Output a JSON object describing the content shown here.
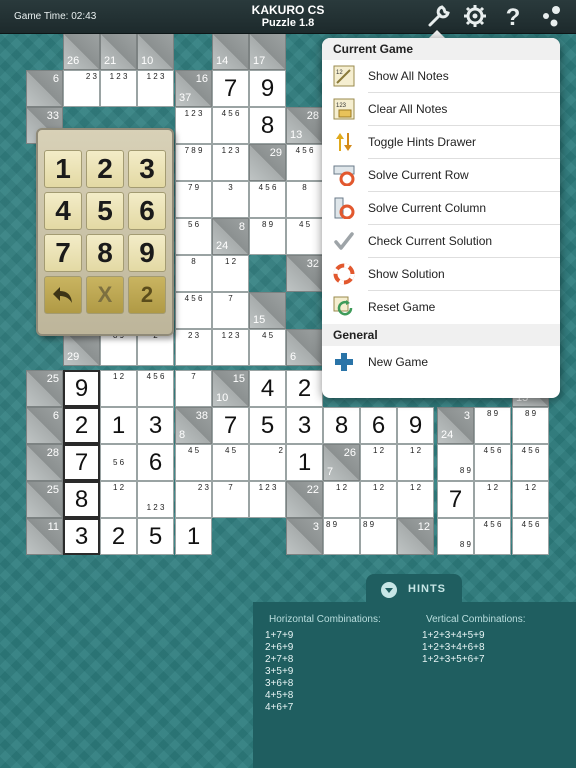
{
  "topbar": {
    "game_time": "Game Time: 02:43",
    "title": "KAKURO CS",
    "subtitle": "Puzzle 1.8",
    "icons": [
      "wrench-icon",
      "gear-icon",
      "help-icon",
      "dots-icon"
    ]
  },
  "numpad": {
    "keys": [
      "1",
      "2",
      "3",
      "4",
      "5",
      "6",
      "7",
      "8",
      "9"
    ],
    "undo_icon": "undo-icon",
    "clear_label": "X",
    "notes_label": "2"
  },
  "menu": {
    "section1": "Current Game",
    "items": [
      {
        "label": "Show All Notes",
        "icon": "show-notes-icon"
      },
      {
        "label": "Clear All Notes",
        "icon": "clear-notes-icon"
      },
      {
        "label": "Toggle Hints Drawer",
        "icon": "toggle-arrows-icon"
      },
      {
        "label": "Solve Current Row",
        "icon": "solve-row-icon"
      },
      {
        "label": "Solve Current Column",
        "icon": "solve-column-icon"
      },
      {
        "label": "Check Current Solution",
        "icon": "checkmark-icon"
      },
      {
        "label": "Show Solution",
        "icon": "lifebuoy-icon"
      },
      {
        "label": "Reset Game",
        "icon": "reset-icon"
      }
    ],
    "section2": "General",
    "general_items": [
      {
        "label": "New Game",
        "icon": "plus-icon"
      }
    ]
  },
  "hints": {
    "tab_label": "HINTS",
    "horizontal_title": "Horizontal Combinations:",
    "horizontal": [
      "1+7+9",
      "2+6+9",
      "2+7+8",
      "3+5+9",
      "3+6+8",
      "4+5+8",
      "4+6+7"
    ],
    "vertical_title": "Vertical Combinations:",
    "vertical": [
      "1+2+3+4+5+9",
      "1+2+3+4+6+8",
      "1+2+3+5+6+7"
    ]
  },
  "board": {
    "values": [
      "7",
      "9",
      "8",
      "9",
      "4",
      "2",
      "2",
      "1",
      "3",
      "7",
      "5",
      "3",
      "8",
      "6",
      "9",
      "7",
      "6",
      "1",
      "8",
      "7",
      "3",
      "2",
      "5",
      "1"
    ],
    "clues": [
      "26",
      "21",
      "10",
      "14",
      "17",
      "6",
      "16",
      "37",
      "33",
      "28",
      "13",
      "29",
      "8",
      "24",
      "32",
      "15",
      "29",
      "29",
      "6",
      "25",
      "15",
      "10",
      "12",
      "15",
      "6",
      "38",
      "8",
      "3",
      "24",
      "28",
      "26",
      "7",
      "25",
      "22",
      "11",
      "3",
      "12"
    ],
    "notes": [
      "2 3",
      "1 2 3",
      "1 2 3",
      "1 2 3",
      "4 5 6",
      "7 8 9",
      "1 2 3",
      "4 5 6",
      "7 9",
      "3",
      "4 5 6",
      "8",
      "5 6",
      "8 9",
      "4 5",
      "8",
      "1 2",
      "4 5 6",
      "7",
      "8 9",
      "2",
      "2 3",
      "1 2 3",
      "4 5",
      "1 2",
      "4 5 6",
      "7",
      "8 9"
    ]
  }
}
